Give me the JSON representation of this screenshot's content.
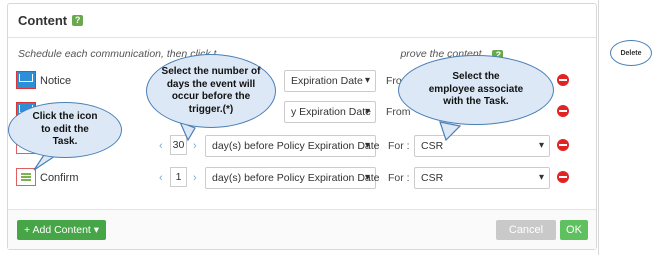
{
  "panel": {
    "title": "Content",
    "help_icon": "?",
    "intro_left": "Schedule each communication, then click t",
    "intro_right": "prove the content."
  },
  "rows": [
    {
      "name": "Notice",
      "icon": "envelope-icon",
      "days": "",
      "event": "Expiration Date",
      "for_label": "From",
      "person": ""
    },
    {
      "name": "",
      "icon": "envelope-icon",
      "days": "",
      "event": "y Expiration Date",
      "for_label": "From",
      "person": ""
    },
    {
      "name": "",
      "icon": "",
      "days": "30",
      "event": "day(s) before Policy Expiration Date",
      "for_label": "For :",
      "person": "CSR"
    },
    {
      "name": "Confirm",
      "icon": "checklist-icon",
      "days": "1",
      "event": "day(s) before Policy Expiration Date",
      "for_label": "For :",
      "person": "CSR"
    }
  ],
  "nav": {
    "prev": "‹",
    "next": "›"
  },
  "footer": {
    "add_label": "+ Add Content ▾",
    "cancel_label": "Cancel",
    "ok_label": "OK"
  },
  "callouts": {
    "days": "Select the number of\ndays the event will\noccur before  the\ntrigger.(*)",
    "employee": "Select the\nemployee associate\nwith the Task.",
    "edit": "Click the icon\nto edit the\nTask.",
    "delete": "Delete"
  },
  "colors": {
    "accent_green": "#46a546",
    "delete_red": "#e02424",
    "callout_fill": "#dce8f5"
  }
}
